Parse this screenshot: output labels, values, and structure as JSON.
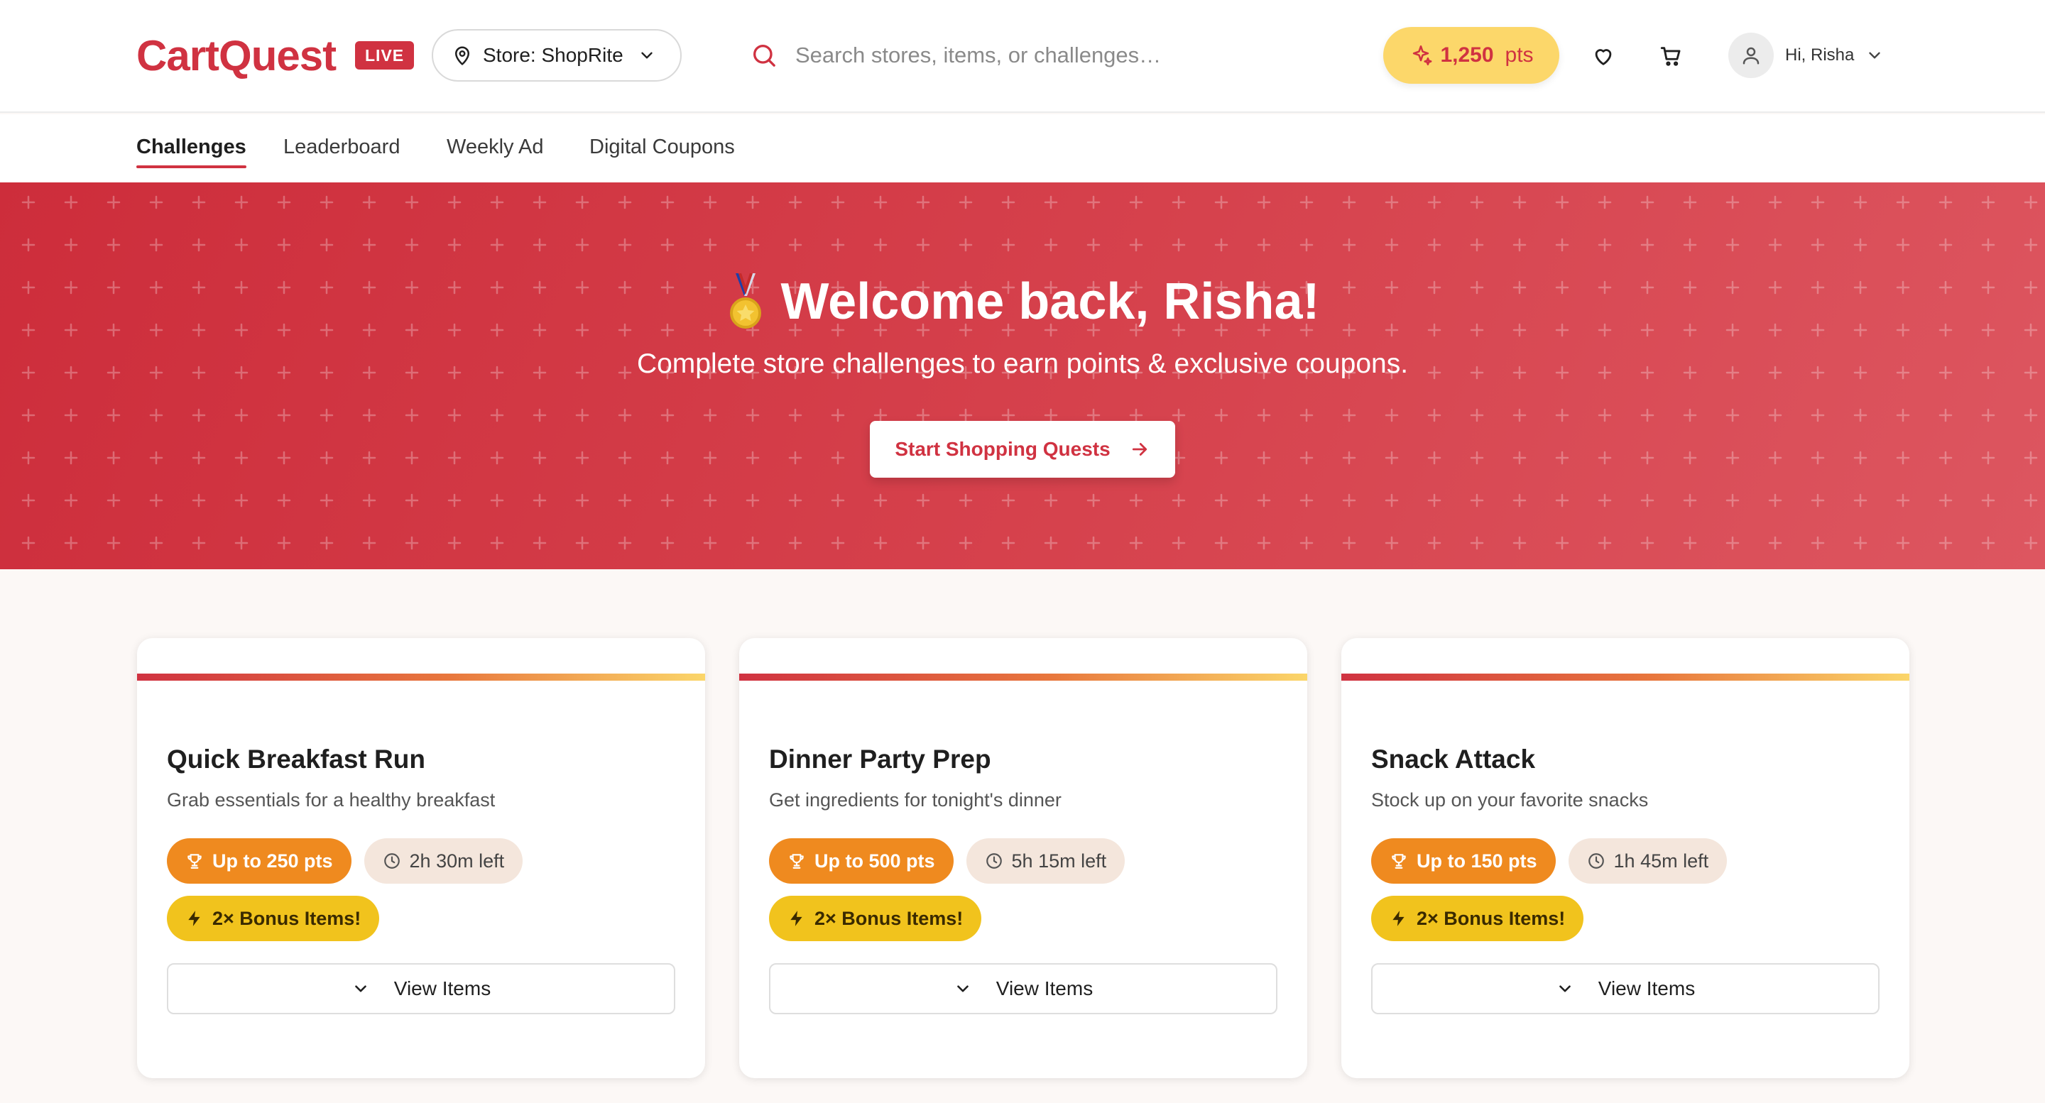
{
  "header": {
    "logo": "CartQuest",
    "live_badge": "LIVE",
    "store_label": "Store: ShopRite",
    "search_placeholder": "Search stores, items, or challenges…",
    "points_value": "1,250",
    "points_unit": "pts",
    "user_greeting": "Hi, Risha"
  },
  "nav": {
    "tabs": [
      {
        "label": "Challenges",
        "active": true
      },
      {
        "label": "Leaderboard",
        "active": false
      },
      {
        "label": "Weekly Ad",
        "active": false
      },
      {
        "label": "Digital Coupons",
        "active": false
      }
    ]
  },
  "hero": {
    "title": "Welcome back, Risha!",
    "subtitle": "Complete store challenges to earn points & exclusive coupons.",
    "cta_label": "Start Shopping Quests"
  },
  "cards": [
    {
      "title": "Quick Breakfast Run",
      "description": "Grab essentials for a healthy breakfast",
      "points": "Up to 250 pts",
      "time_left": "2h 30m left",
      "bonus": "2× Bonus Items!",
      "button": "View Items"
    },
    {
      "title": "Dinner Party Prep",
      "description": "Get ingredients for tonight's dinner",
      "points": "Up to 500 pts",
      "time_left": "5h 15m left",
      "bonus": "2× Bonus Items!",
      "button": "View Items"
    },
    {
      "title": "Snack Attack",
      "description": "Stock up on your favorite snacks",
      "points": "Up to 150 pts",
      "time_left": "1h 45m left",
      "bonus": "2× Bonus Items!",
      "button": "View Items"
    }
  ],
  "colors": {
    "brand_red": "#d03241",
    "points_bg": "#fcd76a",
    "points_tag": "#ef8a1f",
    "bonus_tag": "#f1c31d",
    "time_tag": "#f4e6dc"
  },
  "icons": {
    "store": "map-pin-icon",
    "search": "search-icon",
    "points": "sparkle-icon",
    "wishlist": "heart-icon",
    "cart": "cart-icon",
    "user": "user-icon",
    "hero": "medal-icon",
    "cta": "arrow-right-icon",
    "points_tag": "trophy-icon",
    "time_tag": "clock-icon",
    "bonus_tag": "lightning-icon",
    "view": "chevron-down-icon"
  }
}
